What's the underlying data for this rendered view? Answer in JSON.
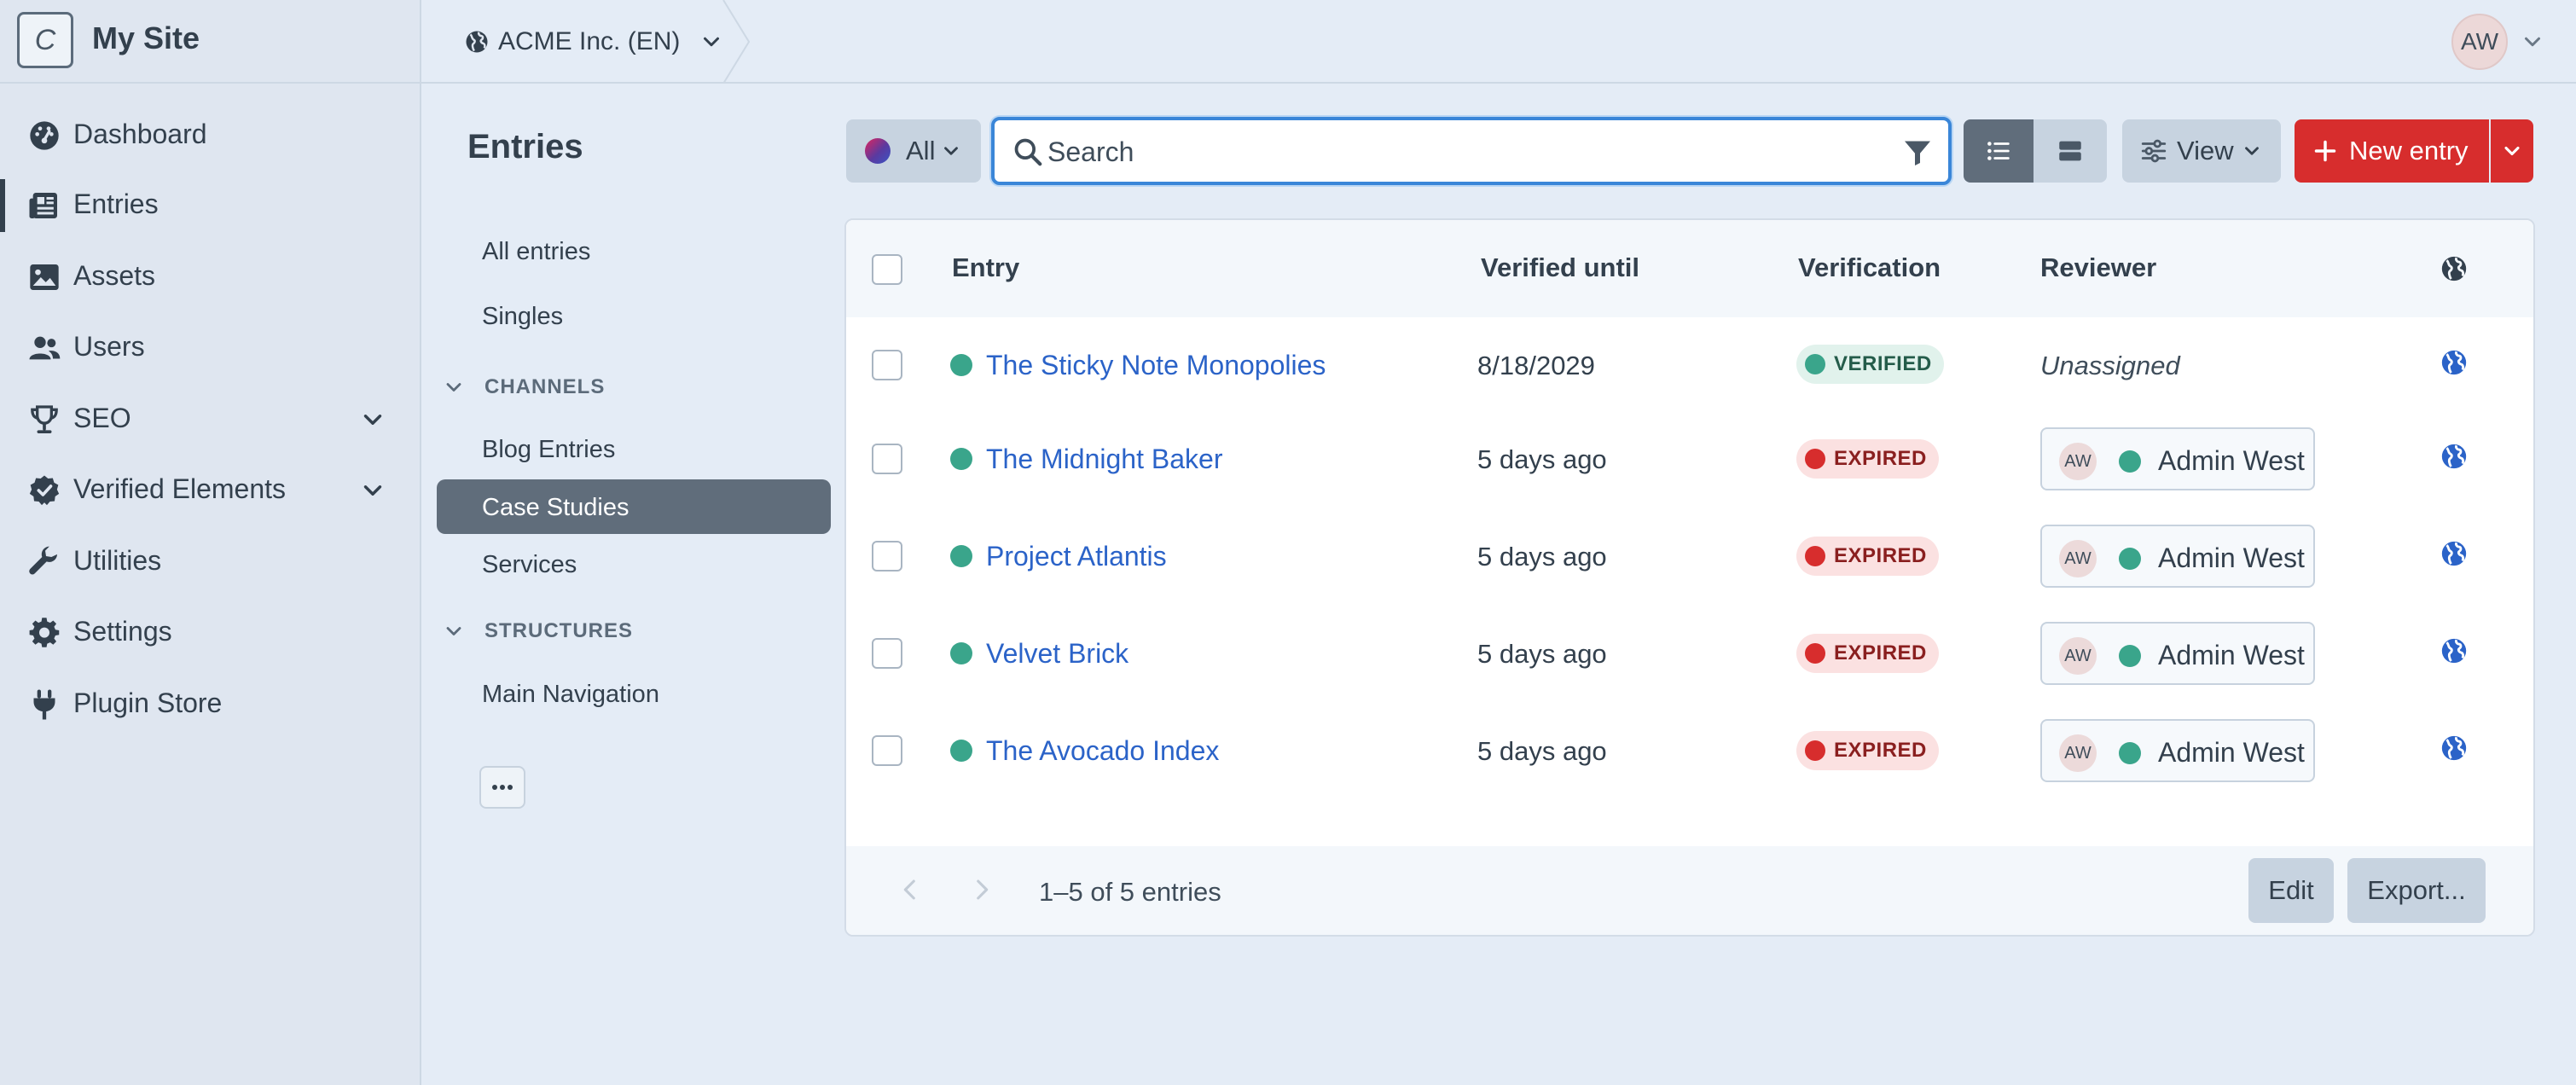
{
  "site": {
    "logo_letter": "C",
    "name": "My Site"
  },
  "nav": {
    "items": [
      {
        "label": "Dashboard",
        "icon": "gauge-icon"
      },
      {
        "label": "Entries",
        "icon": "newspaper-icon"
      },
      {
        "label": "Assets",
        "icon": "image-icon"
      },
      {
        "label": "Users",
        "icon": "users-icon"
      },
      {
        "label": "SEO",
        "icon": "trophy-icon"
      },
      {
        "label": "Verified Elements",
        "icon": "check-badge-icon"
      },
      {
        "label": "Utilities",
        "icon": "wrench-icon"
      },
      {
        "label": "Settings",
        "icon": "gear-icon"
      },
      {
        "label": "Plugin Store",
        "icon": "plug-icon"
      }
    ]
  },
  "topbar": {
    "site_switch": "ACME Inc. (EN)",
    "user_initials": "AW"
  },
  "page": {
    "title": "Entries"
  },
  "sources": {
    "all_entries": "All entries",
    "singles": "Singles",
    "channels_heading": "CHANNELS",
    "blog_entries": "Blog Entries",
    "case_studies": "Case Studies",
    "services": "Services",
    "structures_heading": "STRUCTURES",
    "main_navigation": "Main Navigation"
  },
  "toolbar": {
    "status": "All",
    "search_placeholder": "Search",
    "view_label": "View",
    "new_entry": "New entry"
  },
  "table": {
    "columns": {
      "entry": "Entry",
      "verified_until": "Verified until",
      "verification": "Verification",
      "reviewer": "Reviewer"
    },
    "rows": [
      {
        "title": "The Sticky Note Monopolies",
        "verified_until": "8/18/2029",
        "verification": "VERIFIED",
        "reviewer": "Unassigned"
      },
      {
        "title": "The Midnight Baker",
        "verified_until": "5 days ago",
        "verification": "EXPIRED",
        "reviewer_initials": "AW",
        "reviewer": "Admin West"
      },
      {
        "title": "Project Atlantis",
        "verified_until": "5 days ago",
        "verification": "EXPIRED",
        "reviewer_initials": "AW",
        "reviewer": "Admin West"
      },
      {
        "title": "Velvet Brick",
        "verified_until": "5 days ago",
        "verification": "EXPIRED",
        "reviewer_initials": "AW",
        "reviewer": "Admin West"
      },
      {
        "title": "The Avocado Index",
        "verified_until": "5 days ago",
        "verification": "EXPIRED",
        "reviewer_initials": "AW",
        "reviewer": "Admin West"
      }
    ]
  },
  "footer": {
    "count": "1–5 of 5 entries",
    "edit": "Edit",
    "export": "Export..."
  },
  "colors": {
    "accent_red": "#d72d2d",
    "link_blue": "#2b63c8",
    "status_green": "#3aa58b",
    "focus_blue": "#3a86d8",
    "selected_gray": "#606d7b"
  }
}
